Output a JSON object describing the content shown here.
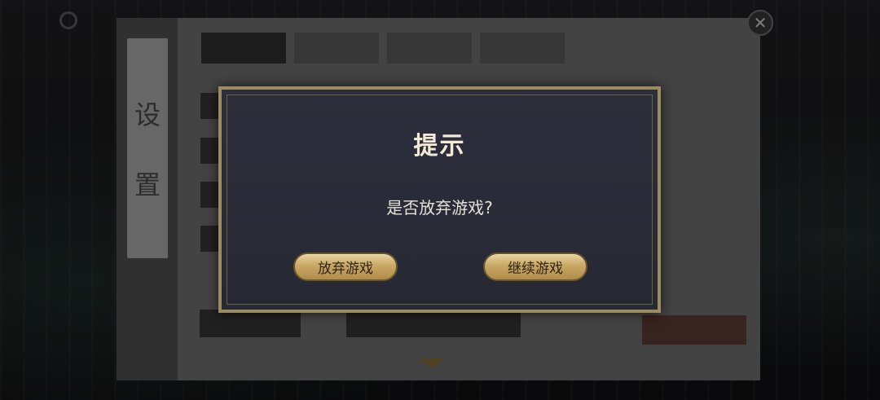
{
  "settings": {
    "title_chars": [
      "设",
      "置"
    ],
    "tabs": [
      {
        "label": ""
      },
      {
        "label": ""
      },
      {
        "label": ""
      },
      {
        "label": ""
      }
    ],
    "bottom_left_label": "",
    "bottom_mid_label": "",
    "exit_label": ""
  },
  "dialog": {
    "title": "提示",
    "message": "是否放弃游戏?",
    "abandon_label": "放弃游戏",
    "continue_label": "继续游戏"
  },
  "close_icon": "close-icon",
  "colors": {
    "dialog_border": "#9c8a60",
    "dialog_bg": "#2a2d39",
    "button_gold": "#c9a764",
    "title_text": "#f2ead6"
  }
}
